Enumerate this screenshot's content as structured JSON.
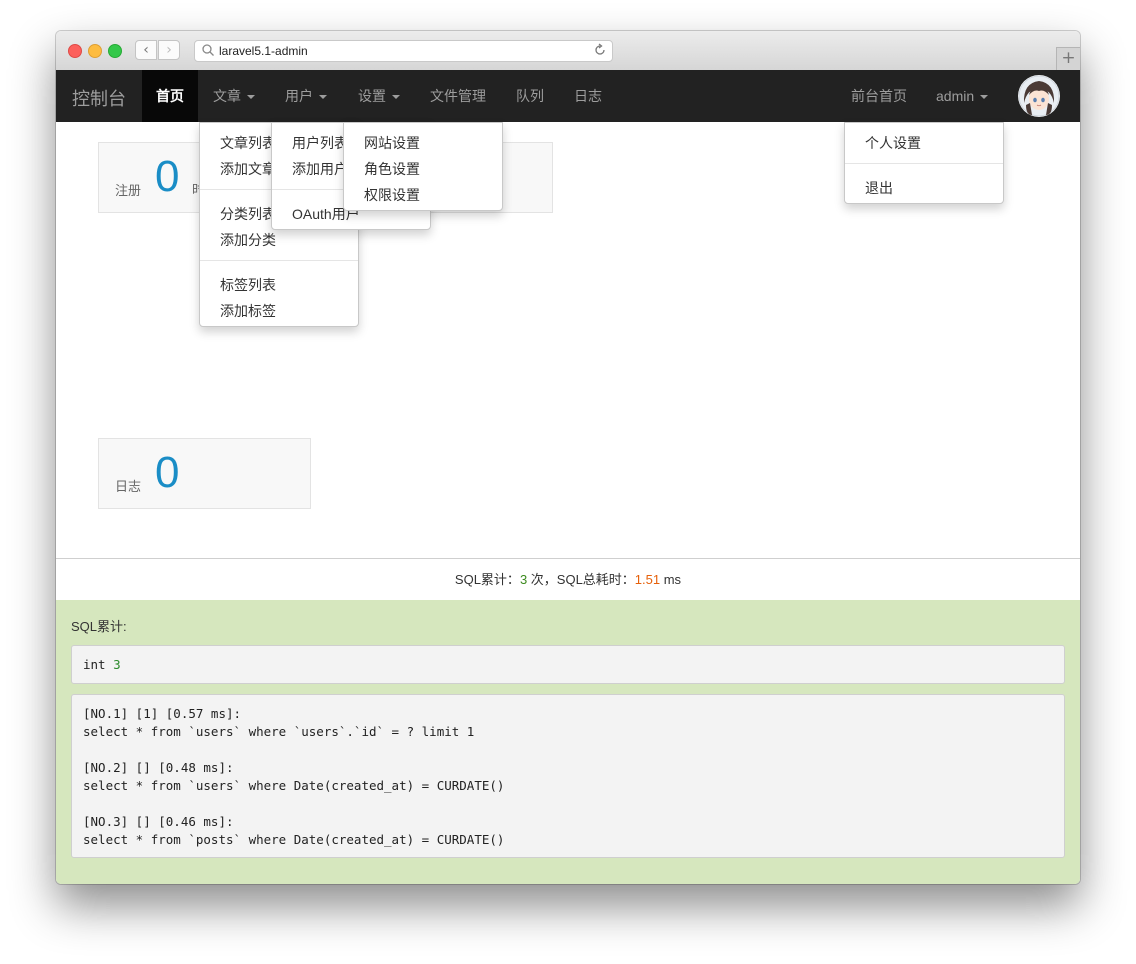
{
  "browser": {
    "url": "laravel5.1-admin"
  },
  "navbar": {
    "brand": "控制台",
    "items": [
      {
        "label": "首页",
        "active": true
      },
      {
        "label": "文章",
        "dropdown": true
      },
      {
        "label": "用户",
        "dropdown": true
      },
      {
        "label": "设置",
        "dropdown": true
      },
      {
        "label": "文件管理"
      },
      {
        "label": "队列"
      },
      {
        "label": "日志"
      }
    ],
    "right_items": [
      {
        "label": "前台首页"
      },
      {
        "label": "admin",
        "dropdown": true
      }
    ]
  },
  "menus": {
    "article": {
      "items": [
        "文章列表",
        "添加文章",
        "分类列表",
        "添加分类",
        "标签列表",
        "添加标签"
      ]
    },
    "user": {
      "items": [
        "用户列表",
        "添加用户",
        "OAuth用户"
      ]
    },
    "settings": {
      "items": [
        "网站设置",
        "角色设置",
        "权限设置"
      ]
    },
    "admin": {
      "items": [
        "个人设置",
        "退出"
      ]
    }
  },
  "stats": [
    {
      "label": "注册",
      "value": "0",
      "extra": "时"
    },
    {
      "label": "日志",
      "value": "0"
    }
  ],
  "sql": {
    "summary_prefix": "SQL累计：",
    "count": "3",
    "summary_mid": " 次，SQL总耗时：",
    "time": "1.51",
    "summary_suffix": " ms",
    "panel_title": "SQL累计:",
    "int_type": "int ",
    "int_value": "3",
    "queries": [
      "[NO.1] [1] [0.57 ms]:",
      "select * from `users` where `users`.`id` = ? limit 1",
      "[NO.2] [] [0.48 ms]:",
      "select * from `users` where Date(created_at) = CURDATE()",
      "[NO.3] [] [0.46 ms]:",
      "select * from `posts` where Date(created_at) = CURDATE()"
    ]
  },
  "colors": {
    "count": "#3c8a1e",
    "time": "#e6600a",
    "stat_value": "#1a8dc6",
    "sql_panel": "#d6e7be"
  }
}
